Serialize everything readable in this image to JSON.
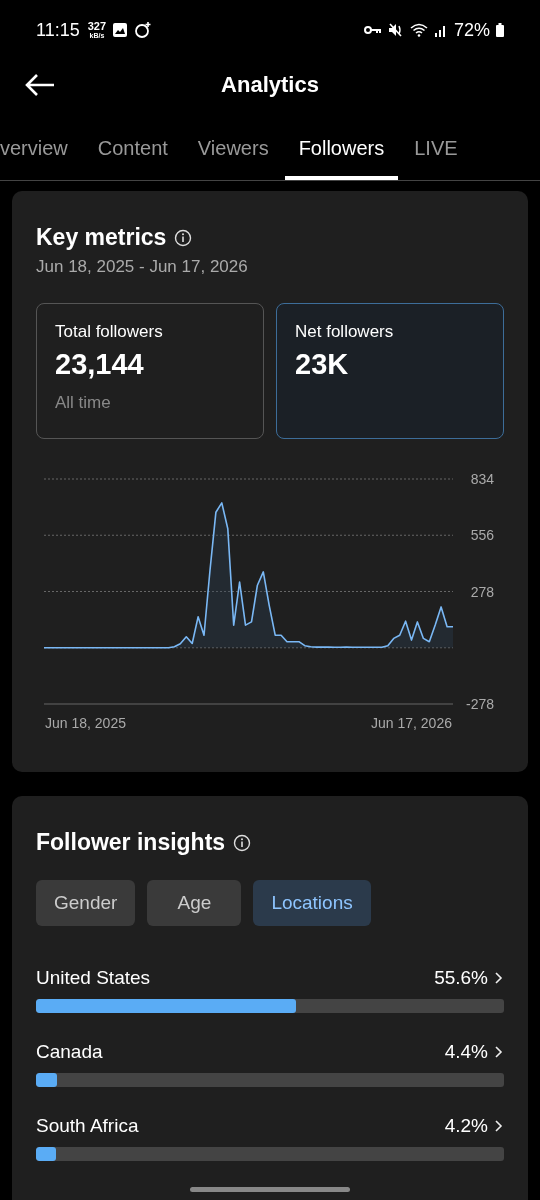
{
  "status_bar": {
    "time": "11:15",
    "speed": "327",
    "speed_unit": "kB/s",
    "battery": "72%"
  },
  "header": {
    "title": "Analytics"
  },
  "tabs": [
    {
      "label": "verview",
      "selected": false
    },
    {
      "label": "Content",
      "selected": false
    },
    {
      "label": "Viewers",
      "selected": false
    },
    {
      "label": "Followers",
      "selected": true
    },
    {
      "label": "LIVE",
      "selected": false
    }
  ],
  "key_metrics": {
    "title": "Key metrics",
    "date_range": "Jun 18, 2025 - Jun 17, 2026",
    "metrics": [
      {
        "label": "Total followers",
        "value": "23,144",
        "note": "All time",
        "selected": false
      },
      {
        "label": "Net followers",
        "value": "23K",
        "selected": true
      }
    ],
    "chart_data": {
      "type": "line",
      "categories": [
        null,
        null,
        null,
        null,
        null,
        null,
        null,
        "Jun 18, 2025",
        null,
        null,
        null,
        null,
        null,
        null,
        null,
        null,
        null,
        null,
        null,
        null,
        null,
        null,
        null,
        null,
        null,
        null,
        null,
        null,
        null,
        null,
        null,
        null,
        null,
        null,
        null,
        null,
        null,
        null,
        null,
        null,
        null,
        null,
        null,
        null,
        null,
        null,
        null,
        null,
        null,
        null,
        null,
        null,
        null,
        null,
        null,
        null,
        null,
        null,
        null,
        null,
        null,
        null,
        "Jun 17, 2026",
        null,
        null,
        null,
        null,
        null,
        null,
        null
      ],
      "ylim": [
        -278,
        834
      ],
      "yticks": [
        -278,
        278,
        556,
        834
      ],
      "series": [
        {
          "color": "#7ab8f5",
          "values": [
            0,
            0,
            0,
            0,
            0,
            0,
            0,
            0,
            0,
            0,
            0,
            0,
            0,
            0,
            0,
            0,
            0,
            0,
            0,
            0,
            0,
            0,
            5,
            20,
            54,
            21,
            153,
            62,
            383,
            670,
            716,
            588,
            112,
            325,
            112,
            128,
            309,
            375,
            210,
            62,
            62,
            30,
            30,
            30,
            10,
            5,
            3,
            3,
            3,
            2,
            2,
            3,
            2,
            2,
            2,
            2,
            2,
            2,
            10,
            46,
            62,
            131,
            38,
            128,
            46,
            30,
            112,
            202,
            104,
            104
          ]
        }
      ]
    }
  },
  "follower_insights": {
    "title": "Follower insights",
    "filters": [
      {
        "label": "Gender",
        "selected": false
      },
      {
        "label": "Age",
        "selected": false
      },
      {
        "label": "Locations",
        "selected": true
      }
    ],
    "locations": [
      {
        "name": "United States",
        "share": "55.6%",
        "level": 0.556
      },
      {
        "name": "Canada",
        "share": "4.4%",
        "level": 0.044
      },
      {
        "name": "South Africa",
        "share": "4.2%",
        "level": 0.042
      }
    ]
  }
}
